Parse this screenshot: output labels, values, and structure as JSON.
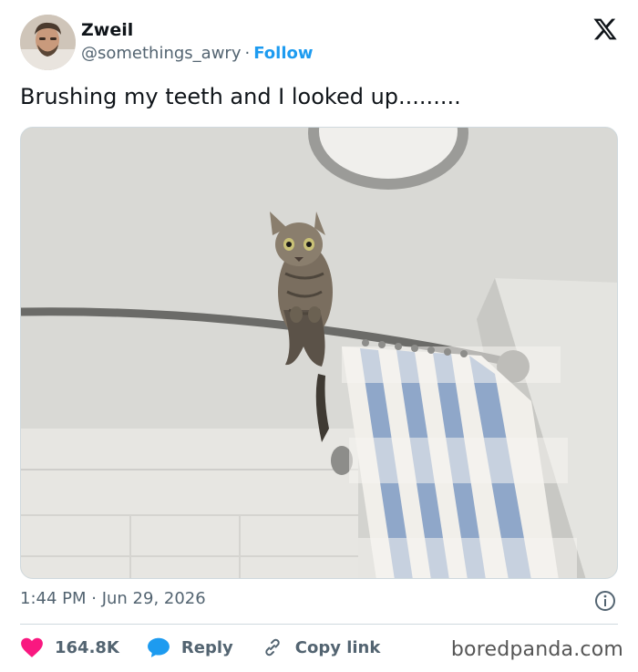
{
  "author": {
    "name": "Zweil",
    "handle": "@somethings_awry",
    "separator": "·",
    "follow_label": "Follow"
  },
  "tweet": {
    "text": "Brushing my teeth and I looked up.........",
    "timestamp": "1:44 PM · Jun 29, 2026"
  },
  "actions": {
    "likes": "164.8K",
    "reply_label": "Reply",
    "copy_link_label": "Copy link"
  },
  "watermark": "boredpanda.com",
  "icons": {
    "logo": "x-logo-icon",
    "heart": "heart-icon",
    "reply": "speech-bubble-icon",
    "link": "link-icon",
    "info": "info-icon"
  },
  "colors": {
    "accent": "#1d9bf0",
    "heart": "#f91880",
    "text": "#0f1419",
    "muted": "#536471",
    "border": "#cfd9de"
  }
}
